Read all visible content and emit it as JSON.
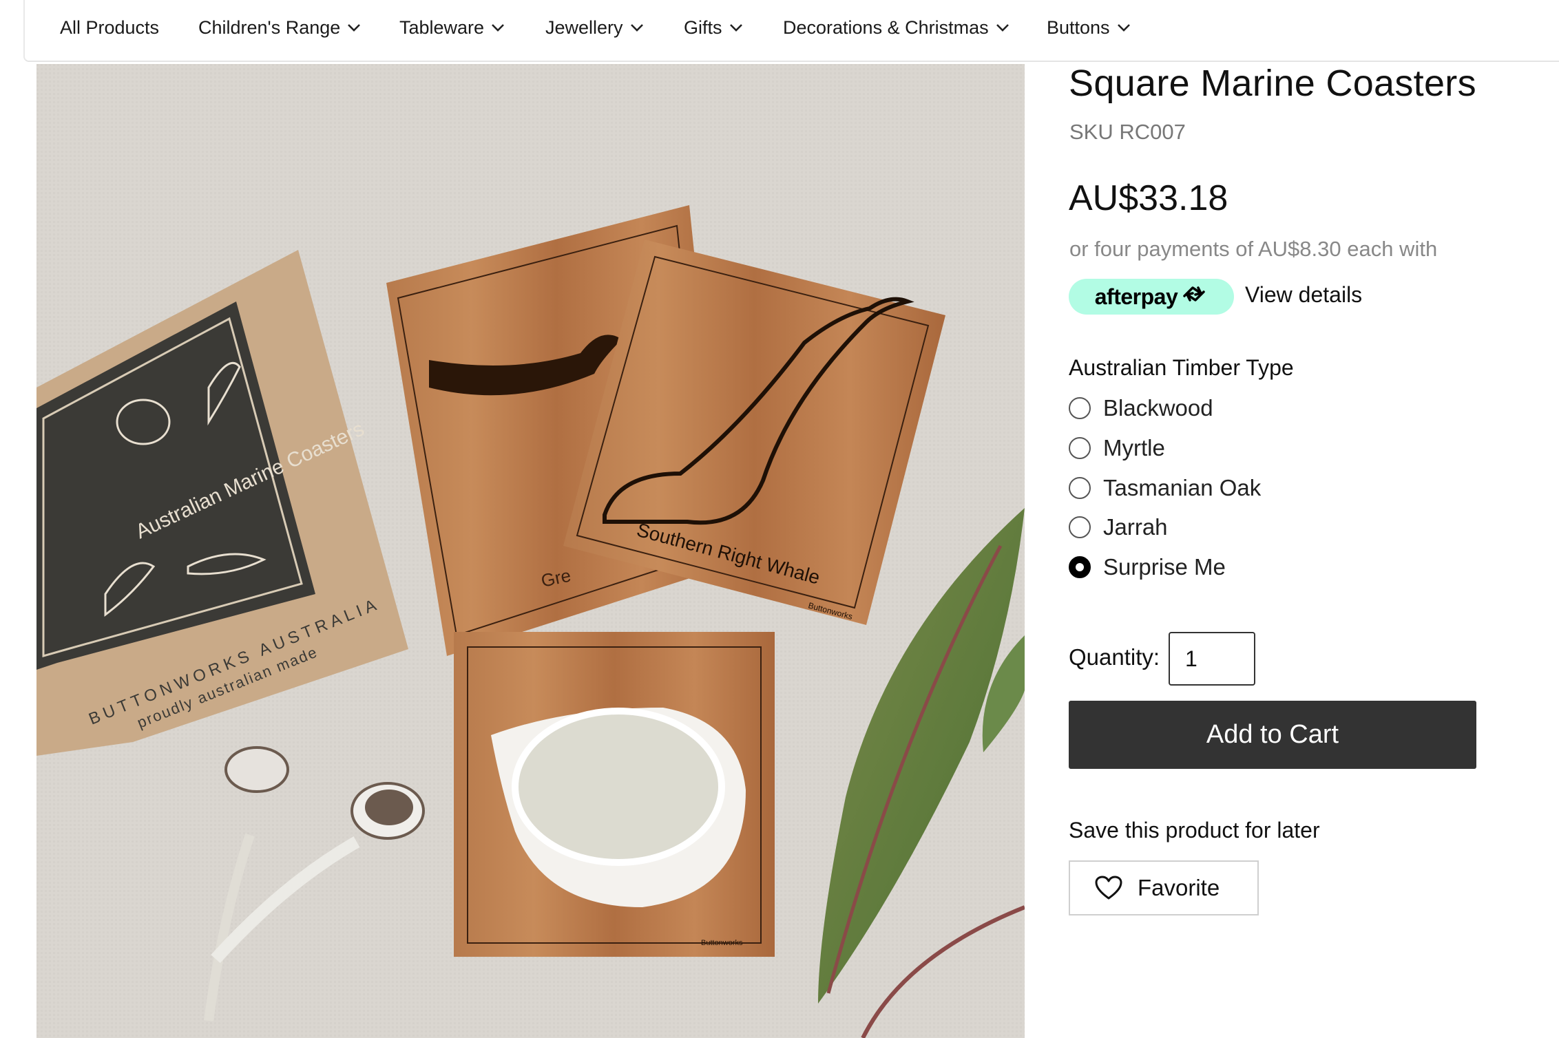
{
  "nav": {
    "items": [
      {
        "label": "All Products",
        "has_dropdown": false
      },
      {
        "label": "Children's Range",
        "has_dropdown": true
      },
      {
        "label": "Tableware",
        "has_dropdown": true
      },
      {
        "label": "Jewellery",
        "has_dropdown": true
      },
      {
        "label": "Gifts",
        "has_dropdown": true
      },
      {
        "label": "Decorations & Christmas",
        "has_dropdown": true
      },
      {
        "label": "Buttons",
        "has_dropdown": true
      }
    ]
  },
  "product": {
    "title": "Square Marine Coasters",
    "sku": "SKU RC007",
    "price": "AU$33.18",
    "afterpay_text": "or four payments of AU$8.30 each with",
    "afterpay_logo": "afterpay",
    "view_details": "View details",
    "image": {
      "box_title": "Australian Marine Coasters",
      "box_brand": "BUTTONWORKS AUSTRALIA",
      "box_tagline": "proudly australian made",
      "coaster_label_1": "Southern Right Whale",
      "coaster_label_2": "Gre",
      "coaster_maker": "Buttonworks"
    }
  },
  "options": {
    "title": "Australian Timber Type",
    "choices": [
      {
        "label": "Blackwood",
        "selected": false
      },
      {
        "label": "Myrtle",
        "selected": false
      },
      {
        "label": "Tasmanian Oak",
        "selected": false
      },
      {
        "label": "Jarrah",
        "selected": false
      },
      {
        "label": "Surprise Me",
        "selected": true
      }
    ]
  },
  "quantity": {
    "label": "Quantity:",
    "value": "1"
  },
  "cart": {
    "add_label": "Add to Cart"
  },
  "save": {
    "title": "Save this product for later",
    "favorite_label": "Favorite"
  },
  "colors": {
    "afterpay_mint": "#b2fce4",
    "button_dark": "#333333"
  }
}
